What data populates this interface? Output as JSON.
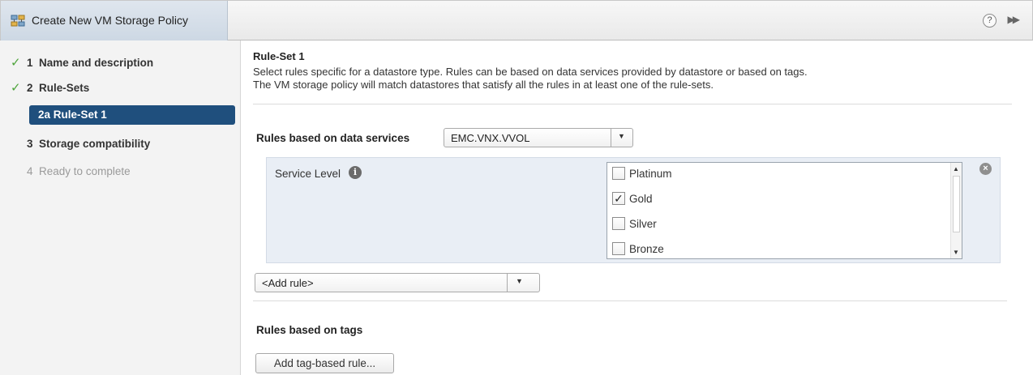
{
  "window": {
    "title": "Create New VM Storage Policy",
    "help_glyph": "?",
    "collapse_glyph": "▶▶"
  },
  "sidebar": {
    "steps": [
      {
        "number": "1",
        "label": "Name and description",
        "status": "complete"
      },
      {
        "number": "2",
        "label": "Rule-Sets",
        "status": "complete"
      },
      {
        "number": "2a",
        "label": "Rule-Set 1",
        "status": "active"
      },
      {
        "number": "3",
        "label": "Storage compatibility",
        "status": "pending"
      },
      {
        "number": "4",
        "label": "Ready to complete",
        "status": "disabled"
      }
    ],
    "check_glyph": "✓"
  },
  "main": {
    "ruleset_title": "Rule-Set 1",
    "description_line1": "Select rules specific for a datastore type. Rules can be based on data services provided by datastore or based on tags.",
    "description_line2": "The VM storage policy will match datastores that satisfy all the rules in at least one of the rule-sets.",
    "data_services_label": "Rules based on data services",
    "data_services_value": "EMC.VNX.VVOL",
    "service_level_label": "Service Level",
    "info_glyph": "i",
    "service_options": [
      {
        "label": "Platinum",
        "checked": false
      },
      {
        "label": "Gold",
        "checked": true
      },
      {
        "label": "Silver",
        "checked": false
      },
      {
        "label": "Bronze",
        "checked": false
      }
    ],
    "check_mark": "✓",
    "remove_glyph": "×",
    "add_rule_value": "<Add rule>",
    "tags_label": "Rules based on tags",
    "add_tag_button": "Add tag-based rule..."
  },
  "colors": {
    "active_step_bg": "#1f4f7d",
    "check_green": "#4ea43b",
    "rule_panel_bg": "#e9eef5"
  }
}
